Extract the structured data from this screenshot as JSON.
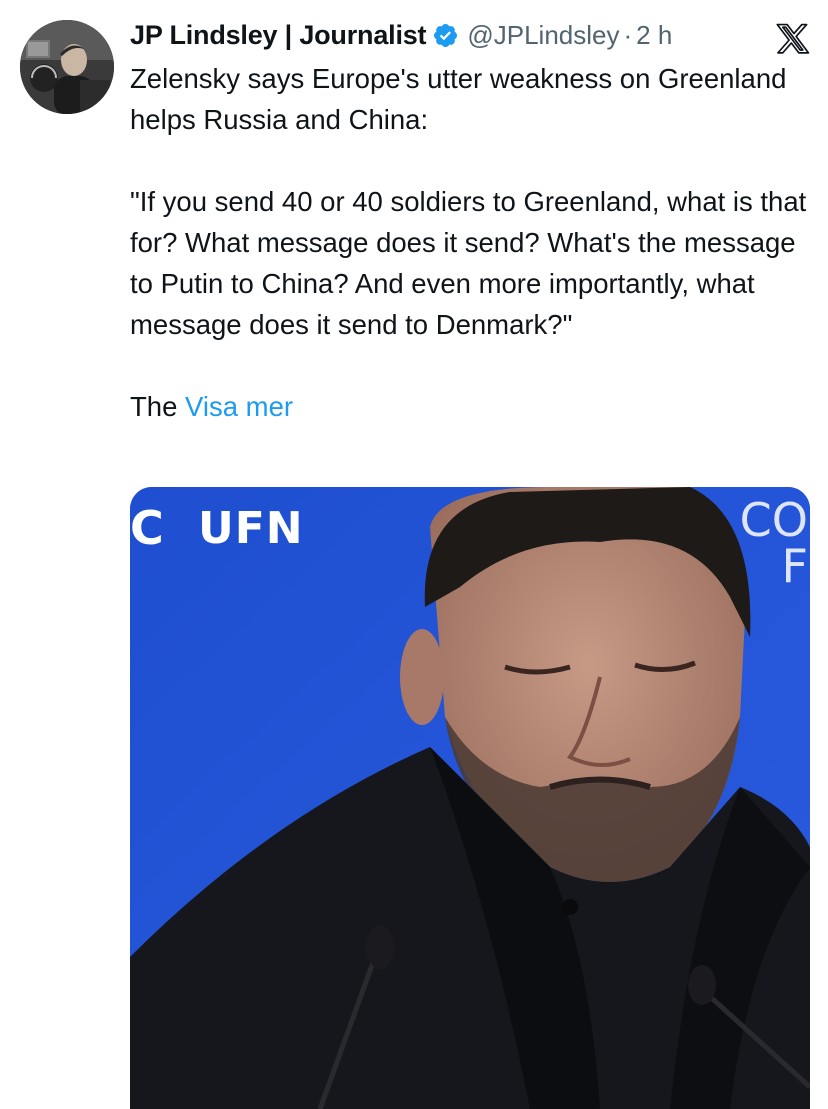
{
  "tweet": {
    "author": {
      "display_name": "JP Lindsley | Journalist",
      "handle": "@JPLindsley",
      "verified": true,
      "avatar_icon": "profile-photo"
    },
    "time_separator": "·",
    "timestamp": "2 h",
    "platform_icon": "x-logo-icon",
    "text": {
      "line1": "Zelensky says Europe's utter weakness on Greenland helps Russia and China:",
      "quote": "\"If you send 40 or 40 soldiers to Greenland, what is that for? What message does it send? What's the message to Putin to China? And even more importantly, what message does it send to Denmark?\"",
      "truncated_start": "The",
      "show_more": "Visa mer"
    },
    "media": {
      "type": "video-still",
      "visible_logo_text": "UFN",
      "visible_edge_text": "C",
      "visible_edge_text_right": "CO\nF"
    }
  },
  "colors": {
    "text_primary": "#0f1419",
    "text_secondary": "#536471",
    "link": "#1d9bf0",
    "verified_badge": "#1d9bf0",
    "media_background": "#1e4fcc"
  }
}
